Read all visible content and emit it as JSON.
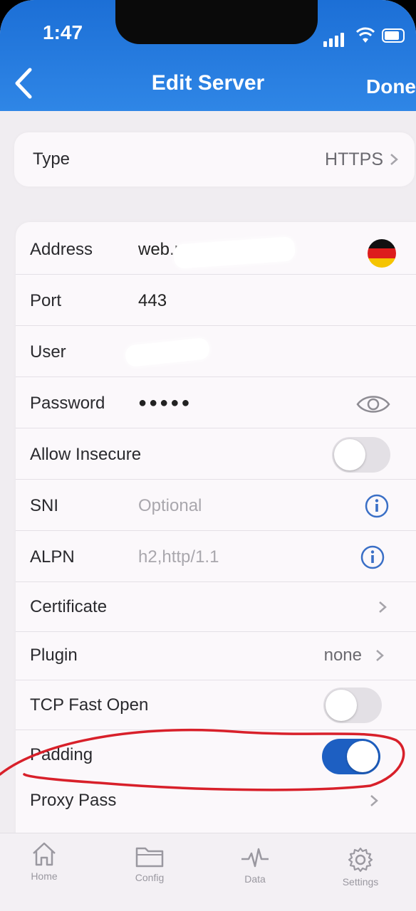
{
  "status_bar": {
    "time": "1:47"
  },
  "nav": {
    "title": "Edit Server",
    "done_label": "Done"
  },
  "type_row": {
    "label": "Type",
    "value": "HTTPS"
  },
  "fields": {
    "address": {
      "label": "Address",
      "value": "web.m"
    },
    "port": {
      "label": "Port",
      "value": "443"
    },
    "user": {
      "label": "User"
    },
    "password": {
      "label": "Password",
      "value": "●●●●●"
    },
    "allow_insecure": {
      "label": "Allow Insecure",
      "on": false
    },
    "sni": {
      "label": "SNI",
      "placeholder": "Optional"
    },
    "alpn": {
      "label": "ALPN",
      "placeholder": "h2,http/1.1"
    },
    "certificate": {
      "label": "Certificate"
    },
    "plugin": {
      "label": "Plugin",
      "value": "none"
    },
    "tcp_fast_open": {
      "label": "TCP Fast Open",
      "on": false
    },
    "padding": {
      "label": "Padding",
      "on": true
    },
    "proxy_pass": {
      "label": "Proxy Pass"
    }
  },
  "tabs": [
    {
      "label": "Home",
      "icon": "home-icon"
    },
    {
      "label": "Config",
      "icon": "folder-icon"
    },
    {
      "label": "Data",
      "icon": "activity-icon"
    },
    {
      "label": "Settings",
      "icon": "gear-icon"
    }
  ],
  "colors": {
    "header_blue": "#1c6fd6",
    "toggle_on": "#1d5fc2",
    "annotation_red": "#d8202a"
  }
}
